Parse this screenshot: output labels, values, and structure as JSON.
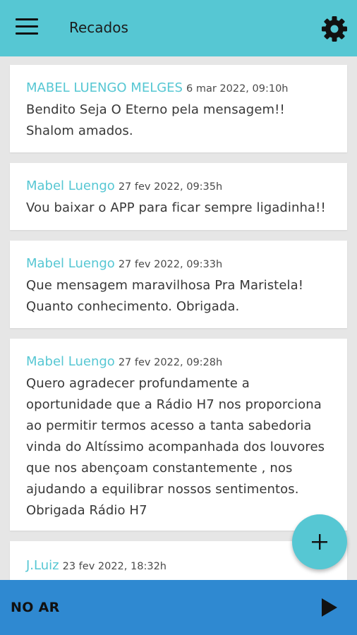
{
  "header": {
    "title": "Recados",
    "menu_icon": "hamburger-menu-icon",
    "settings_icon": "gear-icon"
  },
  "messages": [
    {
      "author": "MABEL LUENGO MELGES",
      "time": "6 mar 2022, 09:10h",
      "text": "Bendito Seja O Eterno pela mensagem!! Shalom amados."
    },
    {
      "author": "Mabel Luengo",
      "time": "27 fev 2022, 09:35h",
      "text": "Vou baixar o APP para ficar sempre ligadinha!!"
    },
    {
      "author": "Mabel Luengo",
      "time": "27 fev 2022, 09:33h",
      "text": "Que mensagem maravilhosa Pra Maristela! Quanto conhecimento. Obrigada."
    },
    {
      "author": "Mabel Luengo",
      "time": "27 fev 2022, 09:28h",
      "text": "Quero agradecer profundamente a oportunidade que a Rádio H7 nos proporciona ao permitir termos acesso a tanta sabedoria vinda do Altíssimo acompanhada dos louvores que nos abençoam constantemente , nos ajudando a equilibrar nossos sentimentos. Obrigada Rádio H7"
    },
    {
      "author": "J.Luiz",
      "time": "23 fev 2022, 18:32h",
      "text": ""
    }
  ],
  "fab": {
    "icon": "plus-icon"
  },
  "player": {
    "label": "NO AR",
    "icon": "play-icon"
  },
  "colors": {
    "accent": "#56c7d3",
    "player_bar": "#2f89d1",
    "background": "#e6e6e6"
  }
}
